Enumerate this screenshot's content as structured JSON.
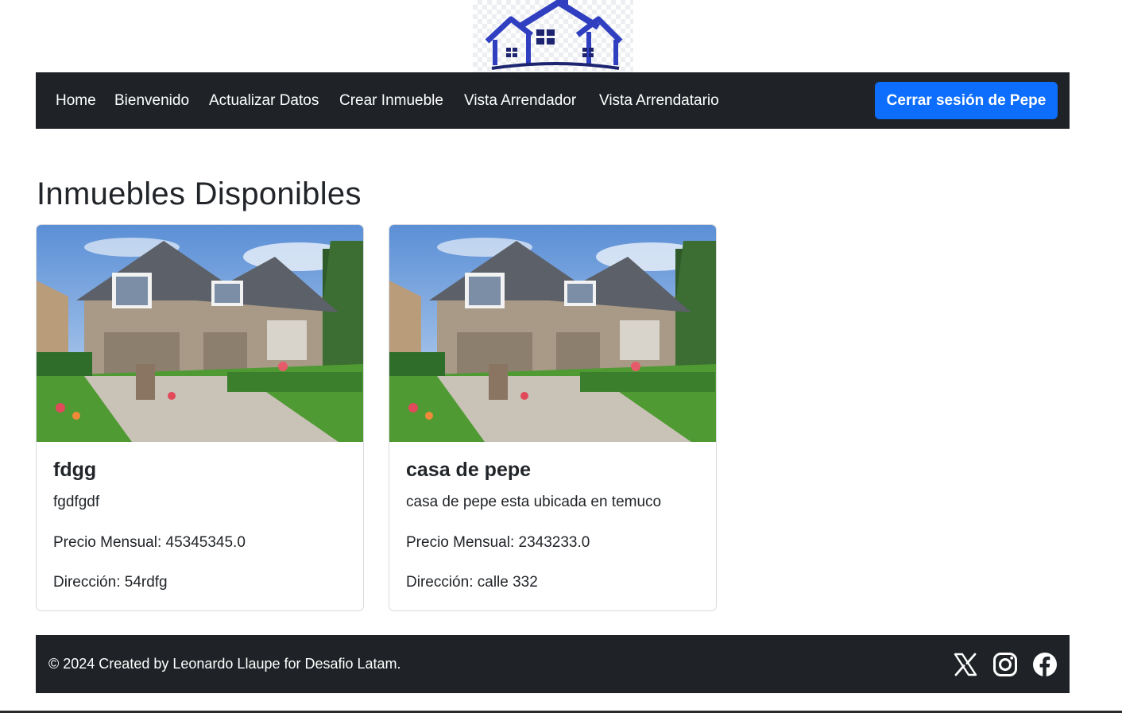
{
  "logo": {
    "icon": "house-logo-icon",
    "colors": {
      "roof": "#2f3fc0",
      "windows": "#1d2470"
    }
  },
  "navbar": {
    "items": [
      {
        "label": "Home"
      },
      {
        "label": "Bienvenido"
      },
      {
        "label": "Actualizar Datos"
      },
      {
        "label": "Crear Inmueble"
      },
      {
        "label": "Vista Arrendador"
      },
      {
        "label": "Vista Arrendatario"
      }
    ],
    "logout_label": "Cerrar sesión de Pepe",
    "background": "#1f2327",
    "accent": "#0d6efd"
  },
  "main": {
    "title": "Inmuebles Disponibles",
    "cards": [
      {
        "image_icon": "house-photo",
        "title": "fdgg",
        "description": "fgdfgdf",
        "price": "Precio Mensual: 45345345.0",
        "address": "Dirección: 54rdfg"
      },
      {
        "image_icon": "house-photo",
        "title": "casa de pepe",
        "description": "casa de pepe esta ubicada en temuco",
        "price": "Precio Mensual: 2343233.0",
        "address": "Dirección: calle 332"
      }
    ]
  },
  "footer": {
    "text": "© 2024 Created by Leonardo Llaupe for Desafio Latam.",
    "social": [
      {
        "icon": "x-twitter-icon"
      },
      {
        "icon": "instagram-icon"
      },
      {
        "icon": "facebook-icon"
      }
    ]
  }
}
